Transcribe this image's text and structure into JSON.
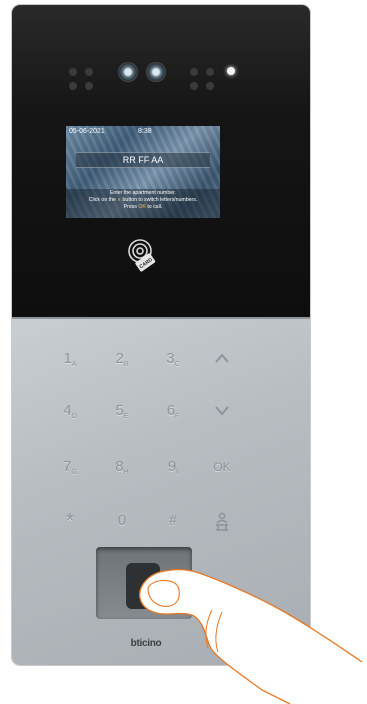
{
  "screen": {
    "date": "05-06-2021",
    "time": "8:38",
    "entry_value": "RR FF AA",
    "help_line1": "Enter the apartment number.",
    "help_line2_a": "Click on the ",
    "help_line2_icon": "∧",
    "help_line2_b": " button to switch letters/numbers.",
    "help_line3_a": "Press ",
    "help_line3_ok": "OK",
    "help_line3_b": " to call."
  },
  "card_reader": {
    "label": "CARD",
    "icon": "contactless-card-icon"
  },
  "keypad": {
    "row1": [
      {
        "main": "1",
        "sub": "A"
      },
      {
        "main": "2",
        "sub": "B"
      },
      {
        "main": "3",
        "sub": "C"
      },
      {
        "icon": "chevron-up-icon"
      }
    ],
    "row2": [
      {
        "main": "4",
        "sub": "D"
      },
      {
        "main": "5",
        "sub": "E"
      },
      {
        "main": "6",
        "sub": "F"
      },
      {
        "icon": "chevron-down-icon"
      }
    ],
    "row3": [
      {
        "main": "7",
        "sub": "G"
      },
      {
        "main": "8",
        "sub": "H"
      },
      {
        "main": "9",
        "sub": "I"
      },
      {
        "main": "OK",
        "sub": ""
      }
    ],
    "row4": [
      {
        "main": "*",
        "sub": ""
      },
      {
        "main": "0",
        "sub": ""
      },
      {
        "main": "#",
        "sub": ""
      },
      {
        "icon": "concierge-icon"
      }
    ]
  },
  "brand": {
    "logo_text": "bticino"
  },
  "colors": {
    "ok_highlight": "#f1c232",
    "glass": "#121212",
    "metal": "#b7bdc1",
    "finger_outline": "#e87722"
  }
}
